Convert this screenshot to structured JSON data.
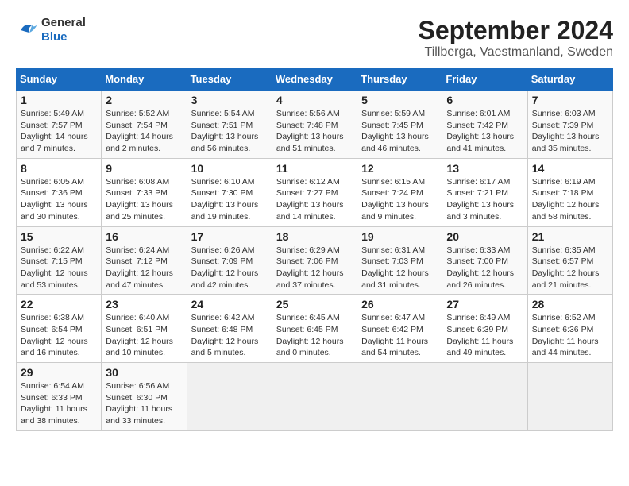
{
  "header": {
    "logo_line1": "General",
    "logo_line2": "Blue",
    "title": "September 2024",
    "subtitle": "Tillberga, Vaestmanland, Sweden"
  },
  "columns": [
    "Sunday",
    "Monday",
    "Tuesday",
    "Wednesday",
    "Thursday",
    "Friday",
    "Saturday"
  ],
  "weeks": [
    [
      {
        "day": "1",
        "sunrise": "Sunrise: 5:49 AM",
        "sunset": "Sunset: 7:57 PM",
        "daylight": "Daylight: 14 hours and 7 minutes."
      },
      {
        "day": "2",
        "sunrise": "Sunrise: 5:52 AM",
        "sunset": "Sunset: 7:54 PM",
        "daylight": "Daylight: 14 hours and 2 minutes."
      },
      {
        "day": "3",
        "sunrise": "Sunrise: 5:54 AM",
        "sunset": "Sunset: 7:51 PM",
        "daylight": "Daylight: 13 hours and 56 minutes."
      },
      {
        "day": "4",
        "sunrise": "Sunrise: 5:56 AM",
        "sunset": "Sunset: 7:48 PM",
        "daylight": "Daylight: 13 hours and 51 minutes."
      },
      {
        "day": "5",
        "sunrise": "Sunrise: 5:59 AM",
        "sunset": "Sunset: 7:45 PM",
        "daylight": "Daylight: 13 hours and 46 minutes."
      },
      {
        "day": "6",
        "sunrise": "Sunrise: 6:01 AM",
        "sunset": "Sunset: 7:42 PM",
        "daylight": "Daylight: 13 hours and 41 minutes."
      },
      {
        "day": "7",
        "sunrise": "Sunrise: 6:03 AM",
        "sunset": "Sunset: 7:39 PM",
        "daylight": "Daylight: 13 hours and 35 minutes."
      }
    ],
    [
      {
        "day": "8",
        "sunrise": "Sunrise: 6:05 AM",
        "sunset": "Sunset: 7:36 PM",
        "daylight": "Daylight: 13 hours and 30 minutes."
      },
      {
        "day": "9",
        "sunrise": "Sunrise: 6:08 AM",
        "sunset": "Sunset: 7:33 PM",
        "daylight": "Daylight: 13 hours and 25 minutes."
      },
      {
        "day": "10",
        "sunrise": "Sunrise: 6:10 AM",
        "sunset": "Sunset: 7:30 PM",
        "daylight": "Daylight: 13 hours and 19 minutes."
      },
      {
        "day": "11",
        "sunrise": "Sunrise: 6:12 AM",
        "sunset": "Sunset: 7:27 PM",
        "daylight": "Daylight: 13 hours and 14 minutes."
      },
      {
        "day": "12",
        "sunrise": "Sunrise: 6:15 AM",
        "sunset": "Sunset: 7:24 PM",
        "daylight": "Daylight: 13 hours and 9 minutes."
      },
      {
        "day": "13",
        "sunrise": "Sunrise: 6:17 AM",
        "sunset": "Sunset: 7:21 PM",
        "daylight": "Daylight: 13 hours and 3 minutes."
      },
      {
        "day": "14",
        "sunrise": "Sunrise: 6:19 AM",
        "sunset": "Sunset: 7:18 PM",
        "daylight": "Daylight: 12 hours and 58 minutes."
      }
    ],
    [
      {
        "day": "15",
        "sunrise": "Sunrise: 6:22 AM",
        "sunset": "Sunset: 7:15 PM",
        "daylight": "Daylight: 12 hours and 53 minutes."
      },
      {
        "day": "16",
        "sunrise": "Sunrise: 6:24 AM",
        "sunset": "Sunset: 7:12 PM",
        "daylight": "Daylight: 12 hours and 47 minutes."
      },
      {
        "day": "17",
        "sunrise": "Sunrise: 6:26 AM",
        "sunset": "Sunset: 7:09 PM",
        "daylight": "Daylight: 12 hours and 42 minutes."
      },
      {
        "day": "18",
        "sunrise": "Sunrise: 6:29 AM",
        "sunset": "Sunset: 7:06 PM",
        "daylight": "Daylight: 12 hours and 37 minutes."
      },
      {
        "day": "19",
        "sunrise": "Sunrise: 6:31 AM",
        "sunset": "Sunset: 7:03 PM",
        "daylight": "Daylight: 12 hours and 31 minutes."
      },
      {
        "day": "20",
        "sunrise": "Sunrise: 6:33 AM",
        "sunset": "Sunset: 7:00 PM",
        "daylight": "Daylight: 12 hours and 26 minutes."
      },
      {
        "day": "21",
        "sunrise": "Sunrise: 6:35 AM",
        "sunset": "Sunset: 6:57 PM",
        "daylight": "Daylight: 12 hours and 21 minutes."
      }
    ],
    [
      {
        "day": "22",
        "sunrise": "Sunrise: 6:38 AM",
        "sunset": "Sunset: 6:54 PM",
        "daylight": "Daylight: 12 hours and 16 minutes."
      },
      {
        "day": "23",
        "sunrise": "Sunrise: 6:40 AM",
        "sunset": "Sunset: 6:51 PM",
        "daylight": "Daylight: 12 hours and 10 minutes."
      },
      {
        "day": "24",
        "sunrise": "Sunrise: 6:42 AM",
        "sunset": "Sunset: 6:48 PM",
        "daylight": "Daylight: 12 hours and 5 minutes."
      },
      {
        "day": "25",
        "sunrise": "Sunrise: 6:45 AM",
        "sunset": "Sunset: 6:45 PM",
        "daylight": "Daylight: 12 hours and 0 minutes."
      },
      {
        "day": "26",
        "sunrise": "Sunrise: 6:47 AM",
        "sunset": "Sunset: 6:42 PM",
        "daylight": "Daylight: 11 hours and 54 minutes."
      },
      {
        "day": "27",
        "sunrise": "Sunrise: 6:49 AM",
        "sunset": "Sunset: 6:39 PM",
        "daylight": "Daylight: 11 hours and 49 minutes."
      },
      {
        "day": "28",
        "sunrise": "Sunrise: 6:52 AM",
        "sunset": "Sunset: 6:36 PM",
        "daylight": "Daylight: 11 hours and 44 minutes."
      }
    ],
    [
      {
        "day": "29",
        "sunrise": "Sunrise: 6:54 AM",
        "sunset": "Sunset: 6:33 PM",
        "daylight": "Daylight: 11 hours and 38 minutes."
      },
      {
        "day": "30",
        "sunrise": "Sunrise: 6:56 AM",
        "sunset": "Sunset: 6:30 PM",
        "daylight": "Daylight: 11 hours and 33 minutes."
      },
      null,
      null,
      null,
      null,
      null
    ]
  ]
}
